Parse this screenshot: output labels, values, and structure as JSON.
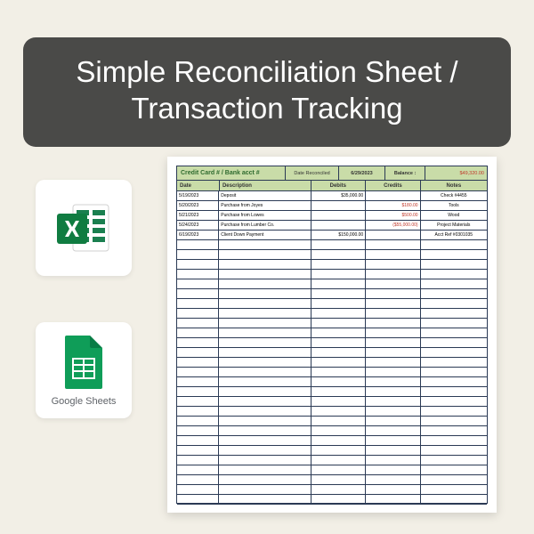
{
  "banner": {
    "title": "Simple Reconciliation Sheet / Transaction Tracking"
  },
  "icons": {
    "excel_label": "Excel",
    "gsheets_label": "Google Sheets"
  },
  "sheet": {
    "title": "Credit Card # / Bank acct #",
    "date_reconciled_label": "Date Reconciled",
    "date_reconciled_value": "6/29/2023",
    "balance_label": "Balance :",
    "balance_value": "$49,320.00",
    "headers": {
      "date": "Date",
      "description": "Description",
      "debits": "Debits",
      "credits": "Credits",
      "notes": "Notes"
    },
    "rows": [
      {
        "date": "5/19/2023",
        "desc": "Deposit",
        "debit": "$35,000.00",
        "credit": "",
        "notes": "Check #4455"
      },
      {
        "date": "5/20/2023",
        "desc": "Purchase from Joyes",
        "debit": "",
        "credit": "$180.00",
        "notes": "Tools"
      },
      {
        "date": "5/21/2023",
        "desc": "Purchase from Lowes",
        "debit": "",
        "credit": "$500.00",
        "notes": "Wood"
      },
      {
        "date": "5/24/2023",
        "desc": "Purchase from Lumber Co.",
        "debit": "",
        "credit": "($55,000.00)",
        "notes": "Project Materials"
      },
      {
        "date": "6/19/2023",
        "desc": "Client Down Payment",
        "debit": "$150,000.00",
        "credit": "",
        "notes": "Acct Ref #0301035"
      }
    ],
    "empty_rows": 27
  }
}
